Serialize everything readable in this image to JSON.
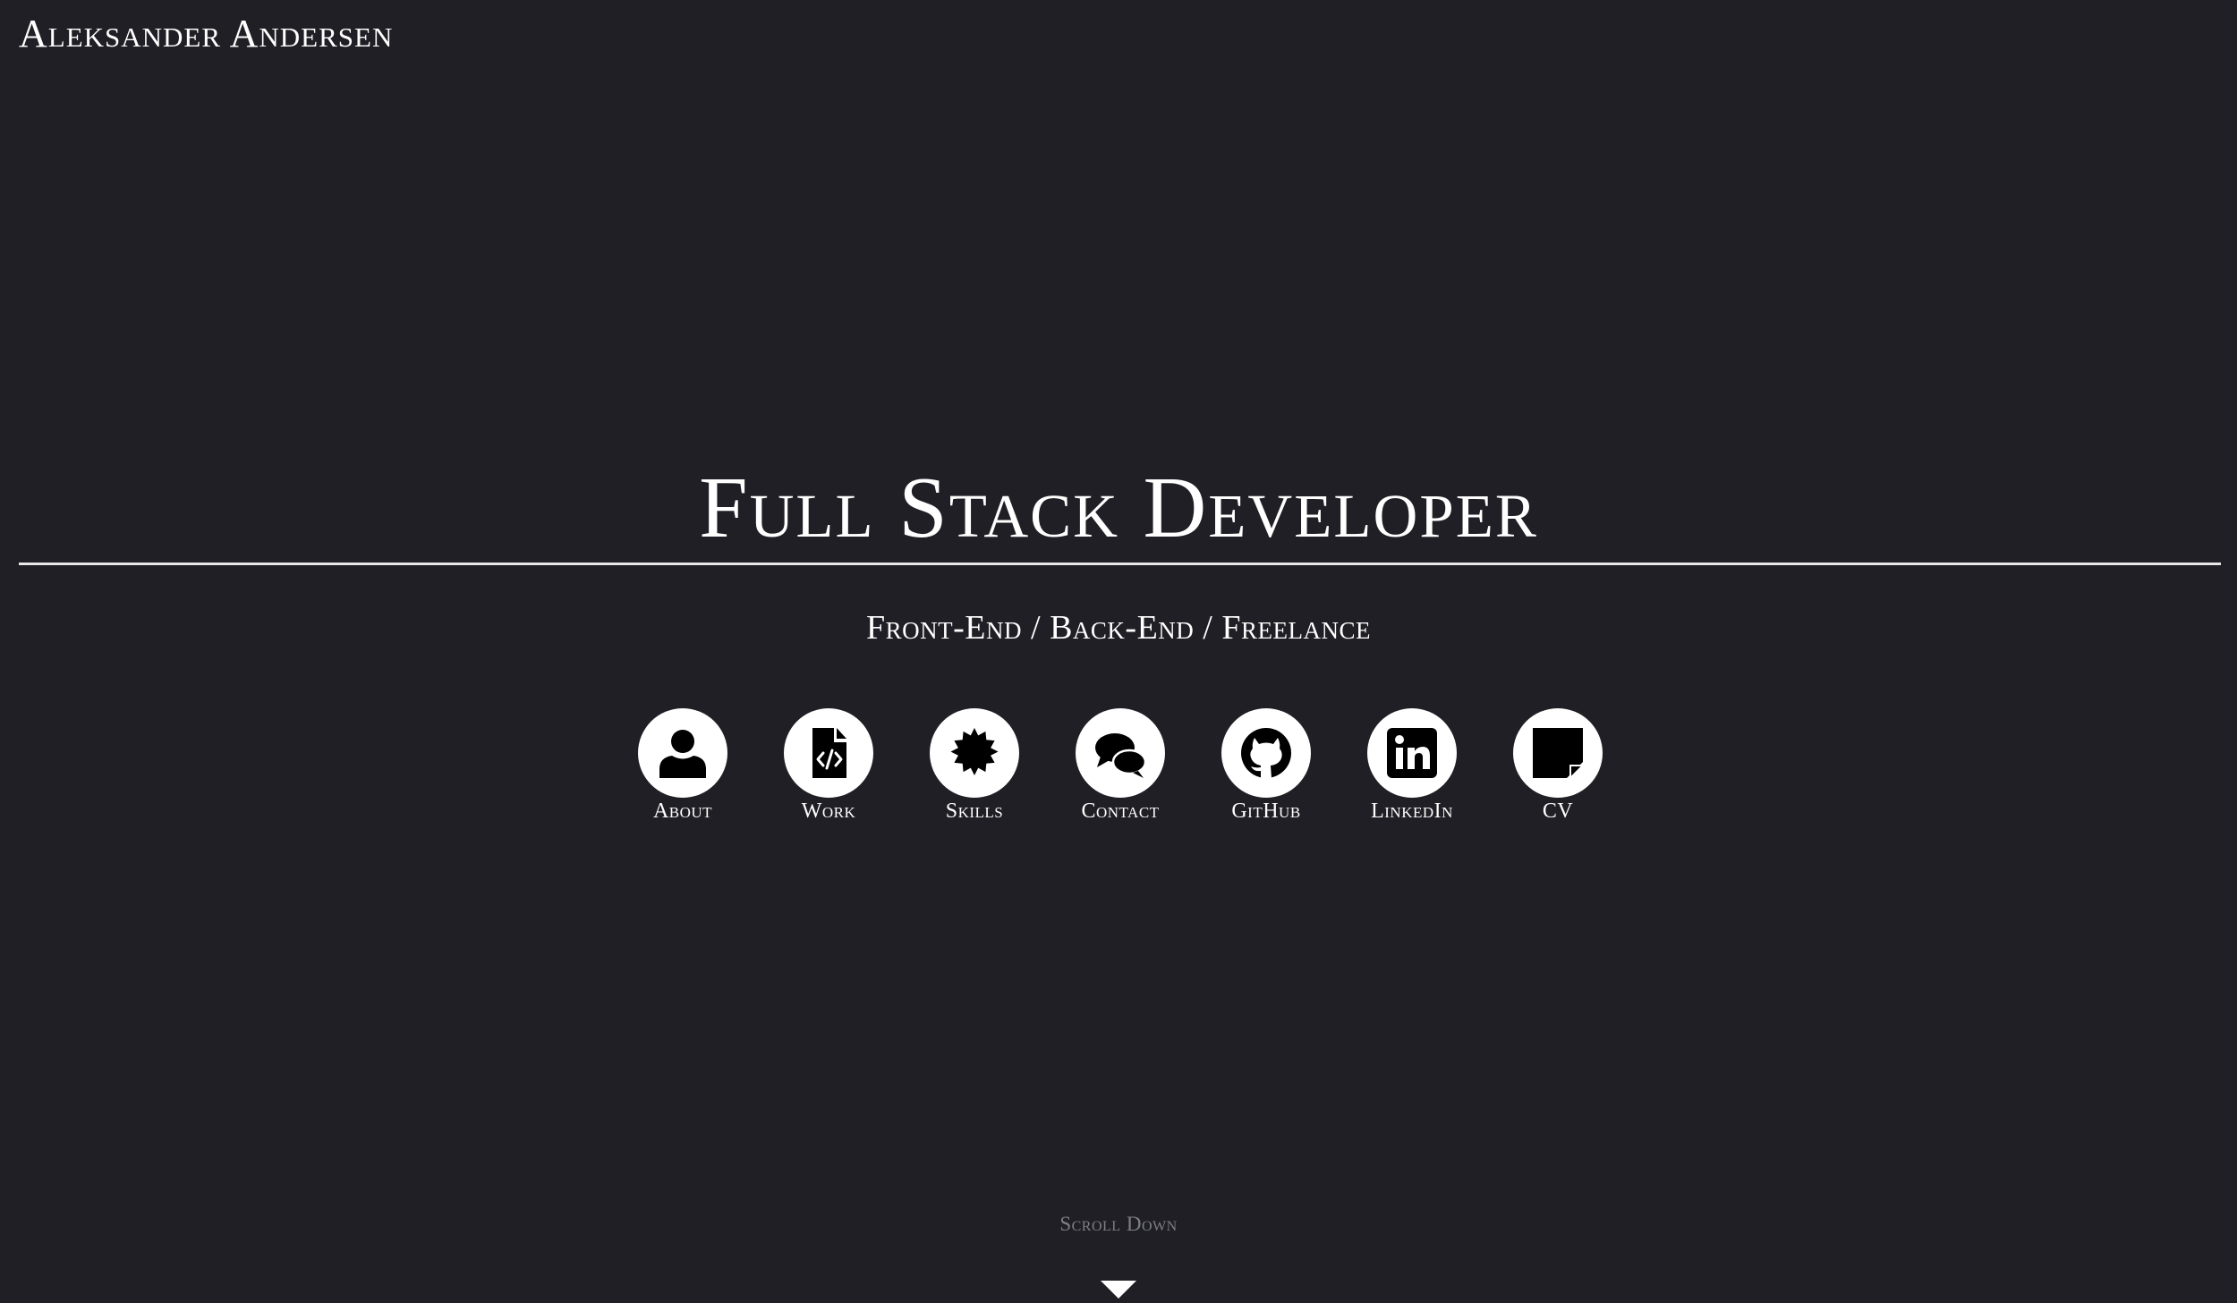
{
  "header": {
    "brand": "Aleksander Andersen"
  },
  "hero": {
    "title": "Full Stack Developer",
    "subtitle": "Front-End / Back-End / Freelance"
  },
  "nav": {
    "items": [
      {
        "label": "About",
        "icon": "user-icon"
      },
      {
        "label": "Work",
        "icon": "file-code-icon"
      },
      {
        "label": "Skills",
        "icon": "certificate-icon"
      },
      {
        "label": "Contact",
        "icon": "comments-icon"
      },
      {
        "label": "GitHub",
        "icon": "github-icon"
      },
      {
        "label": "LinkedIn",
        "icon": "linkedin-icon"
      },
      {
        "label": "CV",
        "icon": "sticky-note-icon"
      }
    ]
  },
  "scroll": {
    "label": "Scroll Down",
    "icon": "chevron-down-icon"
  },
  "colors": {
    "background": "#1f1f25",
    "text": "#ffffff",
    "muted": "#7e7e86",
    "icon_circle": "#ffffff",
    "icon_glyph": "#000000"
  }
}
